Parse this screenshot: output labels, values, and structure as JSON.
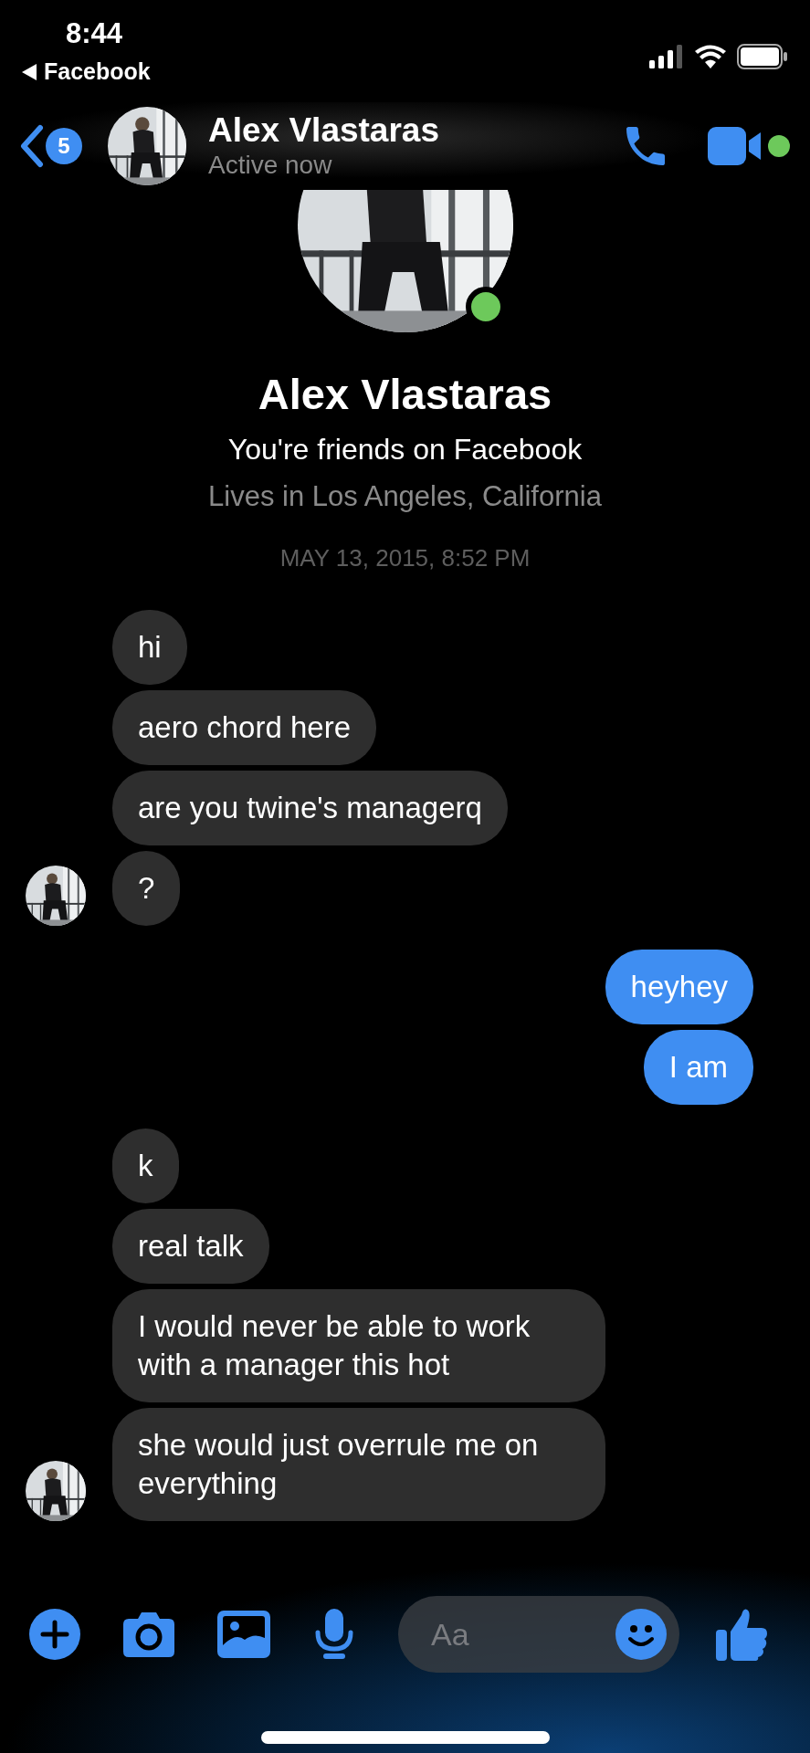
{
  "status_bar": {
    "time": "8:44",
    "back_app": "Facebook"
  },
  "header": {
    "back_count": "5",
    "name": "Alex Vlastaras",
    "status": "Active now",
    "online": true
  },
  "profile": {
    "name": "Alex Vlastaras",
    "relation": "You're friends on Facebook",
    "location": "Lives in Los Angeles, California",
    "online": true
  },
  "timestamp": "MAY 13, 2015, 8:52 PM",
  "message_groups": [
    {
      "kind": "incoming",
      "messages": [
        "hi",
        "aero chord here",
        "are you twine's managerq",
        "?"
      ]
    },
    {
      "kind": "outgoing",
      "messages": [
        "heyhey",
        "I am"
      ]
    },
    {
      "kind": "incoming",
      "messages": [
        "k",
        "real talk",
        "I would never be able to work with a manager this hot",
        "she would just overrule me on everything"
      ]
    }
  ],
  "composer": {
    "placeholder": "Aa"
  }
}
